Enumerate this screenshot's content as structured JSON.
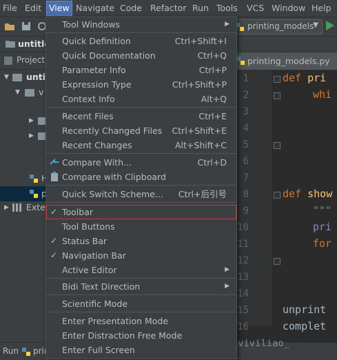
{
  "menubar": {
    "items": [
      "File",
      "Edit",
      "View",
      "Navigate",
      "Code",
      "Refactor",
      "Run",
      "Tools",
      "VCS",
      "Window",
      "Help"
    ]
  },
  "toolbar": {
    "run_config": "printing_models"
  },
  "navbar": {
    "crumb": "untitle"
  },
  "project": {
    "header": "Project",
    "tree": [
      "untitl",
      "v",
      "",
      "",
      "",
      "H",
      "p",
      "Exte"
    ]
  },
  "editor": {
    "tab": "printing_models.py",
    "line_numbers": [
      "1",
      "2",
      "3",
      "4",
      "5",
      "6",
      "7",
      "8",
      "9",
      "10",
      "11",
      "12",
      "13",
      "14",
      "15",
      "16"
    ]
  },
  "code": {
    "def": "def",
    "l1_fn": "pri",
    "l2": "whi",
    "l8_fn": "show",
    "l9": "\"\"\"",
    "l10": "pri",
    "l11": "for",
    "l15": "unprint",
    "l16": "complet"
  },
  "statusbar": {
    "run_label": "Run",
    "run_file": "prir"
  },
  "watermark": "//blog.csdn.net/viviliao_",
  "view_menu": {
    "items": [
      {
        "label": "Tool Windows",
        "shortcut": "",
        "submenu": true
      },
      {
        "label": "Quick Definition",
        "shortcut": "Ctrl+Shift+I"
      },
      {
        "label": "Quick Documentation",
        "shortcut": "Ctrl+Q"
      },
      {
        "label": "Parameter Info",
        "shortcut": "Ctrl+P"
      },
      {
        "label": "Expression Type",
        "shortcut": "Ctrl+Shift+P"
      },
      {
        "label": "Context Info",
        "shortcut": "Alt+Q"
      },
      {
        "label": "Recent Files",
        "shortcut": "Ctrl+E"
      },
      {
        "label": "Recently Changed Files",
        "shortcut": "Ctrl+Shift+E"
      },
      {
        "label": "Recent Changes",
        "shortcut": "Alt+Shift+C"
      },
      {
        "label": "Compare With...",
        "shortcut": "Ctrl+D"
      },
      {
        "label": "Compare with Clipboard",
        "shortcut": ""
      },
      {
        "label": "Quick Switch Scheme...",
        "shortcut": "Ctrl+后引号"
      },
      {
        "label": "Toolbar",
        "shortcut": "",
        "checked": true
      },
      {
        "label": "Tool Buttons",
        "shortcut": ""
      },
      {
        "label": "Status Bar",
        "shortcut": "",
        "checked": true
      },
      {
        "label": "Navigation Bar",
        "shortcut": "",
        "checked": true
      },
      {
        "label": "Active Editor",
        "shortcut": "",
        "submenu": true
      },
      {
        "label": "Bidi Text Direction",
        "shortcut": "",
        "submenu": true
      },
      {
        "label": "Scientific Mode",
        "shortcut": ""
      },
      {
        "label": "Enter Presentation Mode",
        "shortcut": ""
      },
      {
        "label": "Enter Distraction Free Mode",
        "shortcut": ""
      },
      {
        "label": "Enter Full Screen",
        "shortcut": ""
      }
    ]
  },
  "colors": {
    "menu_bg": "#3c3f41",
    "highlight_border": "#d0393a",
    "active_menu": "#4b6eaf",
    "keyword": "#cc7832",
    "function": "#ffc66d"
  }
}
